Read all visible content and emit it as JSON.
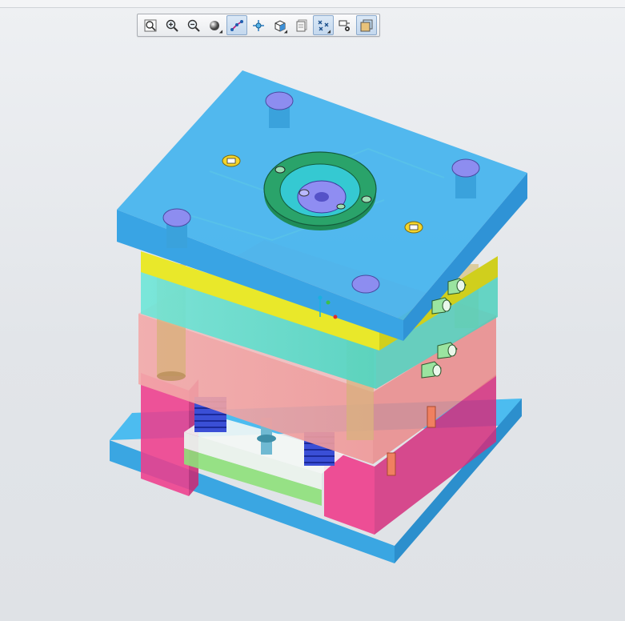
{
  "viewer": {
    "toolbar": [
      {
        "name": "refit-icon",
        "active": false,
        "dropdown": false
      },
      {
        "name": "zoom-in-icon",
        "active": false,
        "dropdown": false
      },
      {
        "name": "zoom-out-icon",
        "active": false,
        "dropdown": false
      },
      {
        "name": "shading-style-icon",
        "active": false,
        "dropdown": true
      },
      {
        "name": "datum-display-icon",
        "active": true,
        "dropdown": false
      },
      {
        "name": "spin-center-icon",
        "active": false,
        "dropdown": false
      },
      {
        "name": "saved-views-icon",
        "active": false,
        "dropdown": true
      },
      {
        "name": "layers-icon",
        "active": false,
        "dropdown": false
      },
      {
        "name": "datum-points-icon",
        "active": true,
        "dropdown": true
      },
      {
        "name": "annotation-display-icon",
        "active": false,
        "dropdown": false
      },
      {
        "name": "appearance-icon",
        "active": false,
        "dropdown": false
      }
    ]
  },
  "colors": {
    "clamp_plate": "#3fb0ec",
    "a_plate": "#e9e82a",
    "cavity_plate": "#5fe3d0",
    "core_plate": "#f19a9a",
    "spacer_block": "#ee3d8c",
    "ejector_plate": "#8ee07a",
    "locating_ring": "#2aa36a",
    "guide_pin_cap": "#8d8df0",
    "fitting": "#9be4a0",
    "bolt_head": "#f5d52a"
  }
}
